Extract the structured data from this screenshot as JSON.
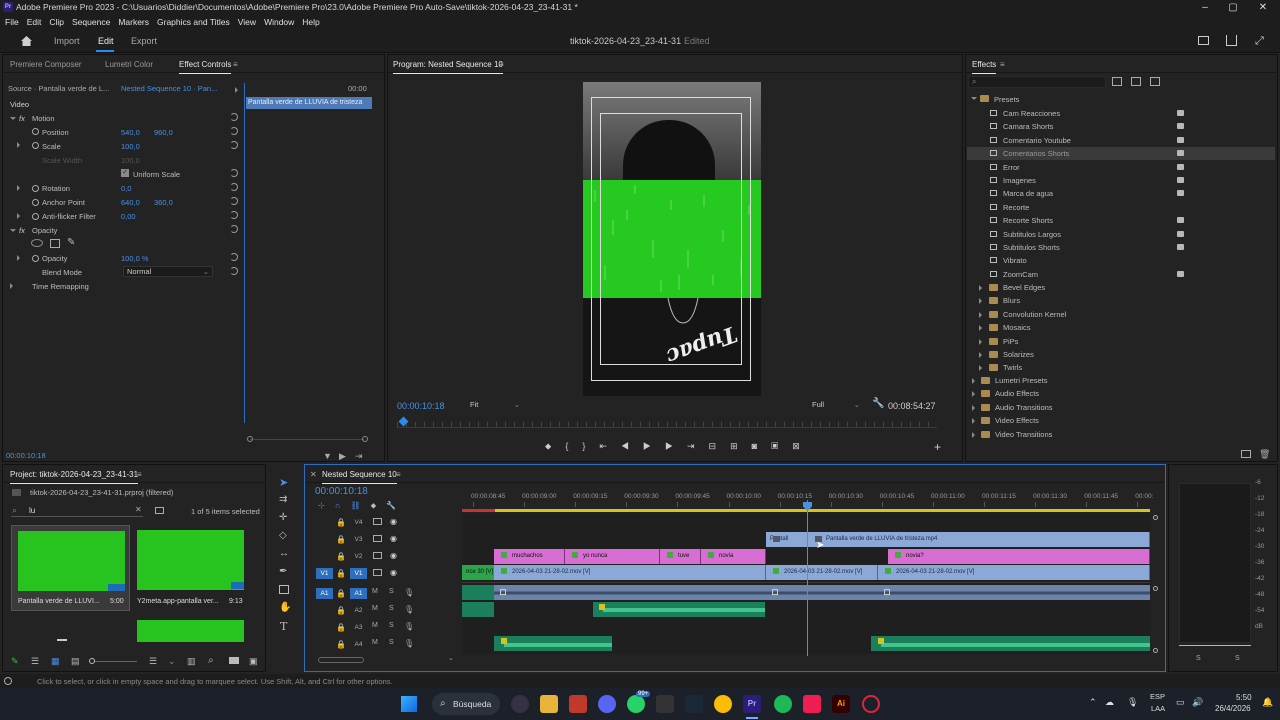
{
  "window": {
    "title": "Adobe Premiere Pro 2023 - C:\\Usuarios\\Diddier\\Documentos\\Adobe\\Premiere Pro\\23.0\\Adobe Premiere Pro Auto-Save\\tiktok-2026-04-23_23-41-31 *"
  },
  "menu": [
    "File",
    "Edit",
    "Clip",
    "Sequence",
    "Markers",
    "Graphics and Titles",
    "View",
    "Window",
    "Help"
  ],
  "header": {
    "tabs": [
      "Import",
      "Edit",
      "Export"
    ],
    "active_tab": "Edit",
    "project_name": "tiktok-2026-04-23_23-41-31",
    "status": "Edited"
  },
  "effect_controls": {
    "tabs": [
      "Premiere Composer",
      "Lumetri Color",
      "Effect Controls"
    ],
    "source": "Source · Pantalla verde de L...",
    "sequence": "Nested Sequence 10 · Pan...",
    "timecode_start": "00:00",
    "clip_label": "Pantalla verde de LLUVIA de tristeza",
    "section": "Video",
    "motion": "Motion",
    "position_label": "Position",
    "position_x": "540,0",
    "position_y": "960,0",
    "scale_label": "Scale",
    "scale_value": "100,0",
    "scale_width_label": "Scale Width",
    "scale_width_value": "100,0",
    "uniform_scale": "Uniform Scale",
    "rotation_label": "Rotation",
    "rotation_value": "0,0",
    "anchor_label": "Anchor Point",
    "anchor_x": "640,0",
    "anchor_y": "360,0",
    "antiflicker_label": "Anti-flicker Filter",
    "antiflicker_value": "0,00",
    "opacity_group": "Opacity",
    "opacity_label": "Opacity",
    "opacity_value": "100,0 %",
    "blend_label": "Blend Mode",
    "blend_value": "Normal",
    "time_remap": "Time Remapping",
    "timecode": "00:00:10:18"
  },
  "program": {
    "title": "Program: Nested Sequence 10",
    "timecode": "00:00:10:18",
    "fit": "Fit",
    "quality": "Full",
    "duration": "00:08:54:27",
    "overlay_text": "Tupac"
  },
  "effects": {
    "title": "Effects",
    "presets_label": "Presets",
    "presets": [
      "Cam Reacciones",
      "Camara Shorts",
      "Comentario Youtube",
      "Comentarios Shorts",
      "Error",
      "Imagenes",
      "Marca de agua",
      "Recorte",
      "Recorte Shorts",
      "Subtitulos Largos",
      "Subtitulos Shorts",
      "Vibrato",
      "ZoomCam"
    ],
    "selected_preset": "Comentarios Shorts",
    "preset_folders": [
      "Bevel Edges",
      "Blurs",
      "Convolution Kernel",
      "Mosaics",
      "PiPs",
      "Solarizes",
      "Twirls"
    ],
    "top_folders": [
      "Lumetri Presets",
      "Audio Effects",
      "Audio Transitions",
      "Video Effects",
      "Video Transitions"
    ]
  },
  "project": {
    "title": "Project: tiktok-2026-04-23_23-41-31",
    "file": "tiktok-2026-04-23_23-41-31.prproj (filtered)",
    "search_value": "lu",
    "count": "1 of 5 items selected",
    "items": [
      {
        "name": "Pantalla verde de LLUVI...",
        "duration": "5:00"
      },
      {
        "name": "Y2meta.app-pantalla ver...",
        "duration": "9:13"
      }
    ]
  },
  "timeline": {
    "title": "Nested Sequence 10",
    "timecode": "00:00:10:18",
    "ticks": [
      "00:00:08:45",
      "00:00:09:00",
      "00:00:09:15",
      "00:00:09:30",
      "00:00:09:45",
      "00:00:10:00",
      "00:00:10:15",
      "00:00:10:30",
      "00:00:10:45",
      "00:00:11:00",
      "00:00:11:15",
      "00:00:11:30",
      "00:00:11:45",
      "00:00:"
    ],
    "video_tracks": [
      "V4",
      "V3",
      "V2",
      "V1"
    ],
    "audio_tracks": [
      "A1",
      "A2",
      "A3",
      "A4"
    ],
    "v1_source": "V1",
    "a1_source": "A1",
    "clips_v2": [
      "muchachos",
      "yo nunca",
      "tuve",
      "novia",
      "novia?"
    ],
    "clip_v3_a": "Pantall",
    "clip_v3_b": "Pantalla verde de LLUVIA de tristeza.mp4",
    "clips_v1": [
      "nce 30 [V]",
      "2026-04-03 21-28-02.mov [V]",
      "2026-04-03 21-28-02.mov [V]",
      "2026-04-03 21-28-02.mov [V]"
    ]
  },
  "audio_meter": {
    "levels": [
      "-6",
      "-12",
      "-18",
      "-24",
      "-30",
      "-36",
      "-42",
      "-48",
      "-54",
      "dB"
    ],
    "solo": "S"
  },
  "status_bar": "Click to select, or click in empty space and drag to marquee select. Use Shift, Alt, and Ctrl for other options.",
  "taskbar": {
    "search": "Búsqueda",
    "lang": "ESP",
    "region": "LAA",
    "time": "5:50",
    "date": "26/4/2026",
    "badge": "99+"
  }
}
